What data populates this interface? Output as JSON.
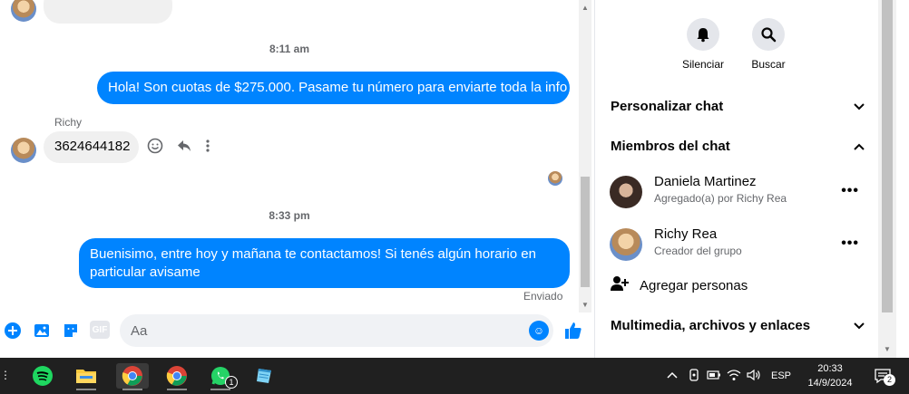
{
  "chat": {
    "timestamp1": "8:11 am",
    "outgoing1": "Hola! Son cuotas de $275.000. Pasame tu número para enviarte toda la info",
    "sender_name": "Richy",
    "incoming1": "3624644182",
    "timestamp2": "8:33 pm",
    "outgoing2": "Buenisimo, entre hoy y mañana te contactamos! Si tenés algún horario en particular avisame",
    "status": "Enviado"
  },
  "composer": {
    "placeholder": "Aa",
    "gif_label": "GIF"
  },
  "info": {
    "mute_label": "Silenciar",
    "search_label": "Buscar",
    "customize_label": "Personalizar chat",
    "members_label": "Miembros del chat",
    "members": [
      {
        "name": "Daniela Martinez",
        "sub": "Agregado(a) por Richy Rea"
      },
      {
        "name": "Richy Rea",
        "sub": "Creador del grupo"
      }
    ],
    "add_people_label": "Agregar personas",
    "media_label": "Multimedia, archivos y enlaces"
  },
  "taskbar": {
    "whatsapp_badge": "1",
    "lang": "ESP",
    "time": "20:33",
    "date": "14/9/2024",
    "notif_count": "2"
  },
  "colors": {
    "messenger_blue": "#0084ff",
    "bubble_gray": "#f0f0f0",
    "taskbar": "#202020"
  }
}
